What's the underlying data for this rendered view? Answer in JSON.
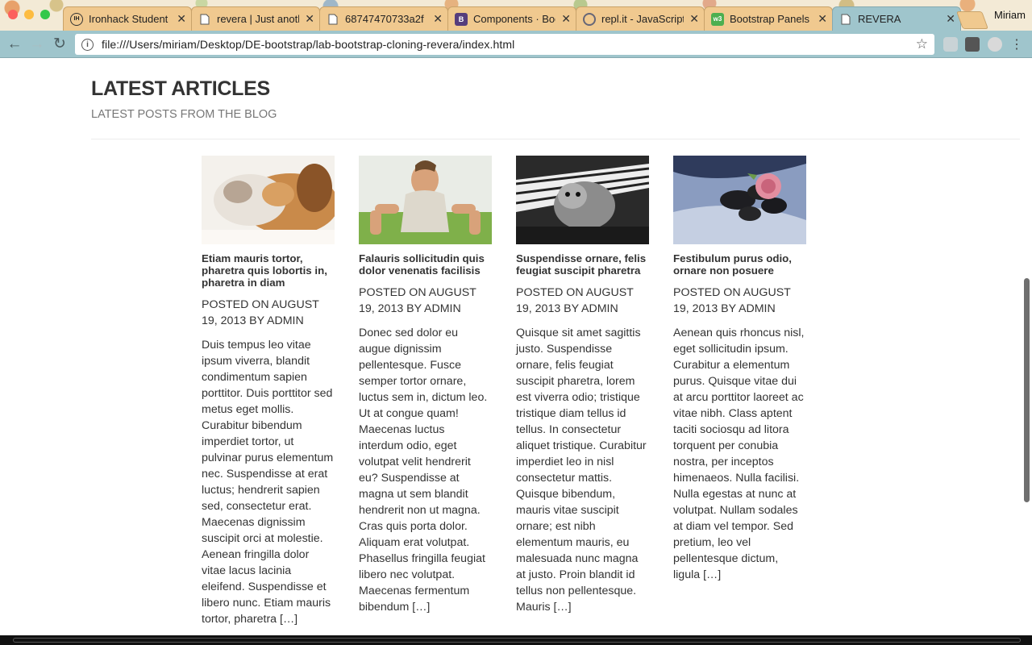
{
  "browser": {
    "tabs": [
      {
        "title": "Ironhack Student",
        "icon": "ih-icon",
        "icon_text": "IH"
      },
      {
        "title": "revera | Just anoth",
        "icon": "page-icon",
        "icon_text": ""
      },
      {
        "title": "68747470733a2f",
        "icon": "page-icon",
        "icon_text": ""
      },
      {
        "title": "Components · Boo",
        "icon": "bootstrap-icon",
        "icon_text": "B"
      },
      {
        "title": "repl.it - JavaScript",
        "icon": "repl-icon",
        "icon_text": ""
      },
      {
        "title": "Bootstrap Panels",
        "icon": "w3-icon",
        "icon_text": "w3"
      },
      {
        "title": "REVERA",
        "icon": "page-icon",
        "icon_text": ""
      }
    ],
    "tab_close": "✕",
    "profile": "Miriam",
    "url": "file:///Users/miriam/Desktop/DE-bootstrap/lab-bootstrap-cloning-revera/index.html",
    "info_glyph": "i",
    "back_glyph": "←",
    "forward_glyph": "→",
    "reload_glyph": "↻",
    "star_glyph": "☆"
  },
  "section": {
    "title": "LATEST ARTICLES",
    "subtitle": "LATEST POSTS FROM THE BLOG"
  },
  "articles": [
    {
      "title": "Etiam mauris tortor, pharetra quis lobortis in, pharetra in diam",
      "meta": "POSTED ON AUGUST 19, 2013 BY ADMIN",
      "excerpt": "Duis tempus leo vitae ipsum viverra, blandit condimentum sapien porttitor. Duis porttitor sed metus eget mollis. Curabitur bibendum imperdiet tortor, ut pulvinar purus elementum nec. Suspendisse at erat luctus; hendrerit sapien sed, consectetur erat. Maecenas dignissim suscipit orci at molestie. Aenean fringilla dolor vitae lacus lacinia eleifend. Suspendisse et libero nunc. Etiam mauris tortor, pharetra […]",
      "image": "cat-and-dog-photo"
    },
    {
      "title": "Falauris sollicitudin quis dolor venenatis facilisis",
      "meta": "POSTED ON AUGUST 19, 2013 BY ADMIN",
      "excerpt": "Donec sed dolor eu augue dignissim pellentesque. Fusce semper tortor ornare, luctus sem in, dictum leo. Ut at congue quam! Maecenas luctus interdum odio, eget volutpat velit hendrerit eu? Suspendisse at magna ut sem blandit hendrerit non ut magna. Cras quis porta dolor. Aliquam erat volutpat. Phasellus fringilla feugiat libero nec volutpat. Maecenas fermentum bibendum […]",
      "image": "man-pushup-photo"
    },
    {
      "title": "Suspendisse ornare, felis feugiat suscipit pharetra",
      "meta": "POSTED ON AUGUST 19, 2013 BY ADMIN",
      "excerpt": "Quisque sit amet sagittis justo. Suspendisse ornare, felis feugiat suscipit pharetra, lorem est viverra odio; tristique tristique diam tellus id tellus. In consectetur aliquet tristique. Curabitur imperdiet leo in nisl consectetur mattis. Quisque bibendum, mauris vitae suscipit ornare; est nibh elementum mauris, eu malesuada nunc magna at justo. Proin blandit id tellus non pellentesque. Mauris […]",
      "image": "kitten-piano-photo"
    },
    {
      "title": "Festibulum purus odio, ornare non posuere",
      "meta": "POSTED ON AUGUST 19, 2013 BY ADMIN",
      "excerpt": "Aenean quis rhoncus nisl, eget sollicitudin ipsum. Curabitur a elementum purus. Quisque vitae dui at arcu porttitor laoreet ac vitae nibh. Class aptent taciti sociosqu ad litora torquent per conubia nostra, per inceptos himenaeos. Nulla facilisi. Nulla egestas at nunc at volutpat. Nullam sodales at diam vel tempor. Sed pretium, leo vel pellentesque dictum, ligula […]",
      "image": "rose-stones-photo"
    }
  ]
}
